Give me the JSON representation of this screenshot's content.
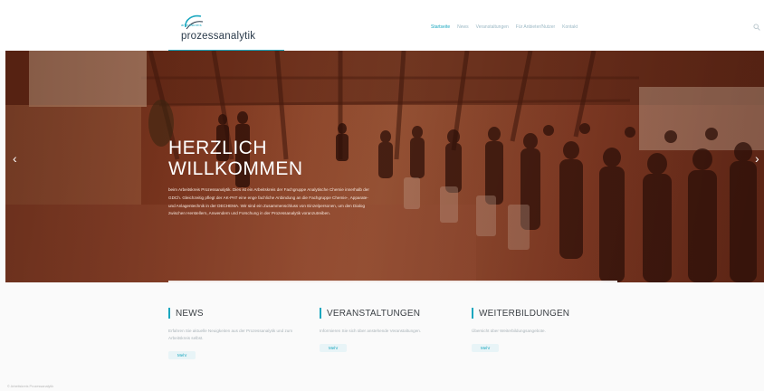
{
  "header": {
    "logo_small": "arbeitskreis",
    "logo_text": "prozessanalytik",
    "nav": [
      {
        "label": "Startseite",
        "active": true
      },
      {
        "label": "News",
        "active": false
      },
      {
        "label": "Veranstaltungen",
        "active": false
      },
      {
        "label": "Für Anbieter/Nutzer",
        "active": false
      },
      {
        "label": "Kontakt",
        "active": false
      }
    ]
  },
  "hero": {
    "title_line1": "HERZLICH",
    "title_line2": "WILLKOMMEN",
    "text": "beim Arbeitskreis Prozessanalytik. Dies ist ein Arbeitskreis der Fachgruppe Analytische Chemie innerhalb der GDCh. Gleichzeitig pflegt der AK-PAT eine enge fachliche Anbindung an die Fachgruppe Chemie-, Apparate- und Anlagentechnik in der DECHEMA. Wir sind ein Zusammenschluss von Einzelpersonen, um den Dialog zwischen Herstellern, Anwendern und Forschung in der Prozessanalytik voranzutreiben.",
    "prev_arrow": "‹",
    "next_arrow": "›"
  },
  "columns": [
    {
      "title": "NEWS",
      "text": "Erfahren Sie aktuelle Neuigkeiten aus der Prozessanalytik und zum Arbeitskreis selbst.",
      "more": "Mehr"
    },
    {
      "title": "VERANSTALTUNGEN",
      "text": "Informieren Sie sich über anstehende Veranstaltungen.",
      "more": "Mehr"
    },
    {
      "title": "WEITERBILDUNGEN",
      "text": "Übersicht über Weiterbildungsangebote.",
      "more": "Mehr"
    }
  ],
  "footer": {
    "text": "© Arbeitskreis Prozessanalytik"
  },
  "colors": {
    "accent": "#1aa7bf",
    "hero_tint": "#8a3e24"
  }
}
